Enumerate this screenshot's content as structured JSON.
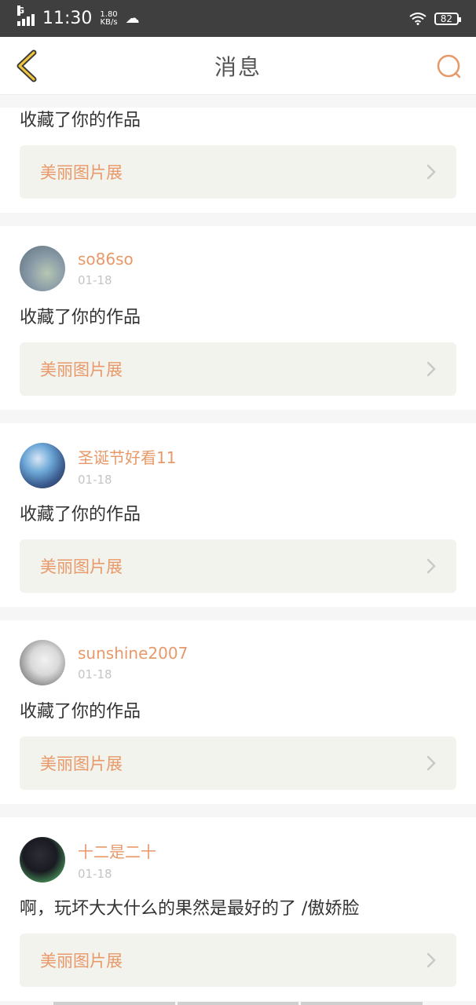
{
  "status": {
    "network": "G",
    "time": "11:30",
    "speed_value": "1.80",
    "speed_unit": "KB/s",
    "battery": "82"
  },
  "header": {
    "title": "消息"
  },
  "colors": {
    "accent": "#e8996a",
    "link_bg": "#f3f3ee"
  },
  "items": [
    {
      "username": "",
      "date": "",
      "message": "收藏了你的作品",
      "work": "美丽图片展"
    },
    {
      "username": "so86so",
      "date": "01-18",
      "message": "收藏了你的作品",
      "work": "美丽图片展"
    },
    {
      "username": "圣诞节好看11",
      "date": "01-18",
      "message": "收藏了你的作品",
      "work": "美丽图片展"
    },
    {
      "username": "sunshine2007",
      "date": "01-18",
      "message": "收藏了你的作品",
      "work": "美丽图片展"
    },
    {
      "username": "十二是二十",
      "date": "01-18",
      "message": "啊，玩坏大大什么的果然是最好的了 /傲娇脸",
      "work": "美丽图片展"
    }
  ]
}
